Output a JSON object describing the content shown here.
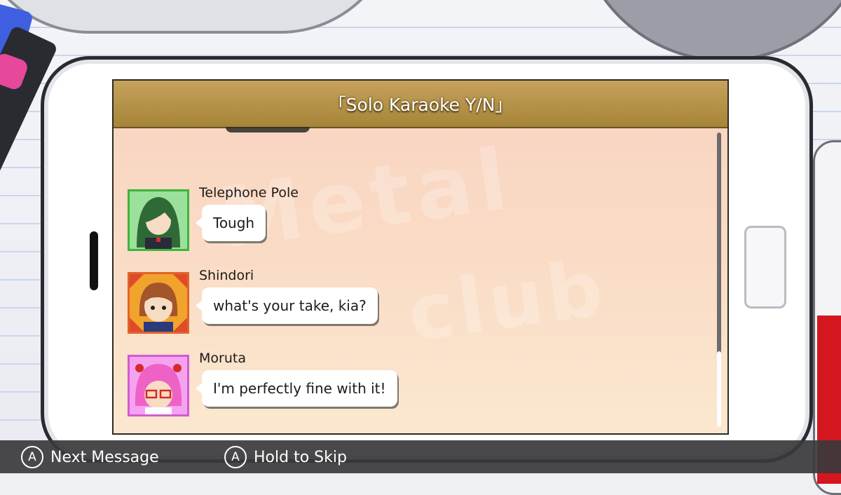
{
  "screen": {
    "title": "「Solo Karaoke Y/N」",
    "watermark": "Metal",
    "watermark2": "club"
  },
  "messages": [
    {
      "sender": "Telephone Pole",
      "text": "Tough",
      "avatar_color": "#3cb53c"
    },
    {
      "sender": "Shindori",
      "text": "what's your take, kia?",
      "avatar_color": "#e0642a"
    },
    {
      "sender": "Moruta",
      "text": "I'm perfectly fine with it!",
      "avatar_color": "#d05cd0"
    }
  ],
  "controls": [
    {
      "button": "A",
      "label": "Next Message"
    },
    {
      "button": "A",
      "label": "Hold to Skip"
    }
  ],
  "colors": {
    "title_bar": "#b8963f",
    "control_bar": "#3a3a3c"
  }
}
